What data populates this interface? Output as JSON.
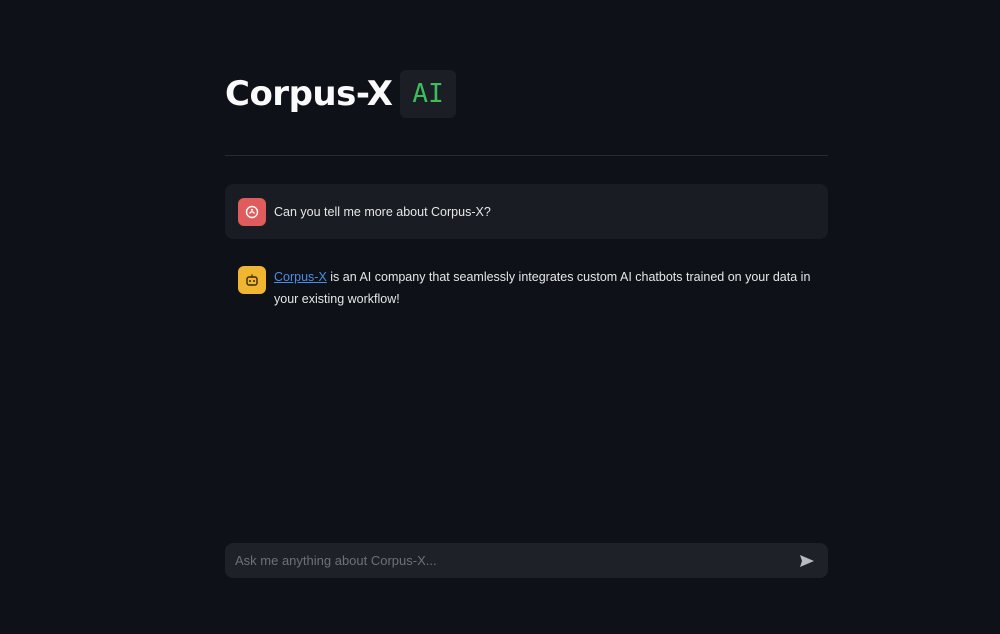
{
  "header": {
    "title": "Corpus-X",
    "badge": "AI"
  },
  "messages": [
    {
      "role": "user",
      "avatar_icon": "user-avatar-icon",
      "text": "Can you tell me more about Corpus-X?"
    },
    {
      "role": "assistant",
      "avatar_icon": "bot-avatar-icon",
      "link_text": "Corpus-X",
      "text": " is an AI company that seamlessly integrates custom AI chatbots trained on your data in your existing workflow!"
    }
  ],
  "chat_input": {
    "placeholder": "Ask me anything about Corpus-X...",
    "value": "",
    "send_icon": "send-icon"
  },
  "colors": {
    "background": "#0e1117",
    "badge_text": "#3cbf5a",
    "user_avatar": "#e05c5c",
    "bot_avatar": "#f0b632",
    "link": "#4a8ee6"
  }
}
